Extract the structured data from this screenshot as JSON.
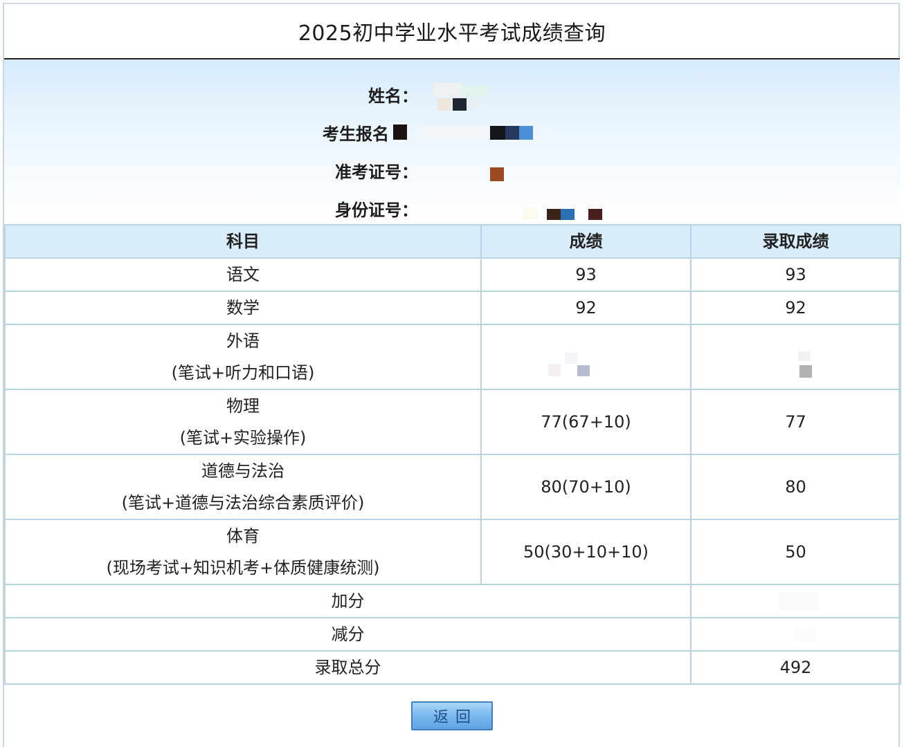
{
  "page": {
    "title": "2025初中学业水平考试成绩查询"
  },
  "info": {
    "name_label": "姓名：",
    "reg_label": "考生报名",
    "ticket_label": "准考证号：",
    "id_label": "身份证号："
  },
  "table": {
    "headers": [
      "科目",
      "成绩",
      "录取成绩"
    ],
    "rows": [
      {
        "subject": "语文",
        "note": "",
        "score": "93",
        "admit": "93"
      },
      {
        "subject": "数学",
        "note": "",
        "score": "92",
        "admit": "92"
      },
      {
        "subject": "外语",
        "note": "(笔试+听力和口语)",
        "score": "",
        "admit": ""
      },
      {
        "subject": "物理",
        "note": "(笔试+实验操作)",
        "score": "77(67+10)",
        "admit": "77"
      },
      {
        "subject": "道德与法治",
        "note": "(笔试+道德与法治综合素质评价)",
        "score": "80(70+10)",
        "admit": "80"
      },
      {
        "subject": "体育",
        "note": "(现场考试+知识机考+体质健康统测)",
        "score": "50(30+10+10)",
        "admit": "50"
      }
    ],
    "bonus_label": "加分",
    "bonus_value": "",
    "deduct_label": "减分",
    "deduct_value": "",
    "total_label": "录取总分",
    "total_value": "492"
  },
  "actions": {
    "back_label": "返回"
  }
}
